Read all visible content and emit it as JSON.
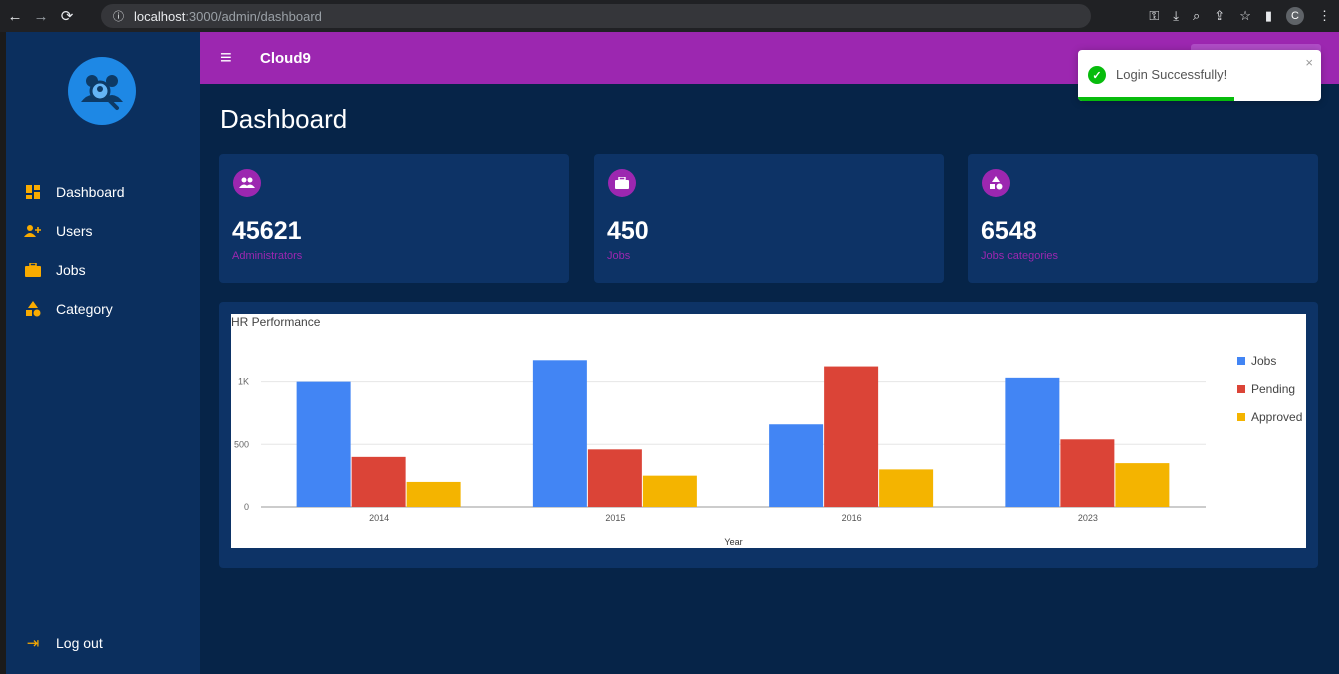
{
  "browser": {
    "url_info_icon": "info-icon",
    "url_host": "localhost",
    "url_path": ":3000/admin/dashboard",
    "profile_initial": "C"
  },
  "app": {
    "brand": "Cloud9",
    "page_title": "Dashboard",
    "accent_color": "#9c27b0"
  },
  "sidebar": {
    "items": [
      {
        "label": "Dashboard",
        "icon": "dashboard-icon"
      },
      {
        "label": "Users",
        "icon": "add-user-icon"
      },
      {
        "label": "Jobs",
        "icon": "briefcase-icon"
      },
      {
        "label": "Category",
        "icon": "category-icon"
      }
    ],
    "logout_label": "Log out"
  },
  "cards": [
    {
      "value": "45621",
      "label": "Administrators",
      "icon": "people-icon"
    },
    {
      "value": "450",
      "label": "Jobs",
      "icon": "briefcase-icon"
    },
    {
      "value": "6548",
      "label": "Jobs categories",
      "icon": "category-icon"
    }
  ],
  "toast": {
    "message": "Login Successfully!",
    "close": "×",
    "progress": 0.64
  },
  "chart_data": {
    "type": "bar",
    "title": "HR Performance",
    "xlabel": "Year",
    "ylabel": "",
    "categories": [
      "2014",
      "2015",
      "2016",
      "2023"
    ],
    "series": [
      {
        "name": "Jobs",
        "color": "#4285f4",
        "values": [
          1000,
          1170,
          660,
          1030
        ]
      },
      {
        "name": "Pending",
        "color": "#db4437",
        "values": [
          400,
          460,
          1120,
          540
        ]
      },
      {
        "name": "Approved",
        "color": "#f4b400",
        "values": [
          200,
          250,
          300,
          350
        ]
      }
    ],
    "yticks": [
      {
        "value": 0,
        "label": "0"
      },
      {
        "value": 500,
        "label": "500"
      },
      {
        "value": 1000,
        "label": "1K"
      }
    ],
    "ylim": [
      0,
      1300
    ],
    "grid": true,
    "legend_position": "right"
  }
}
